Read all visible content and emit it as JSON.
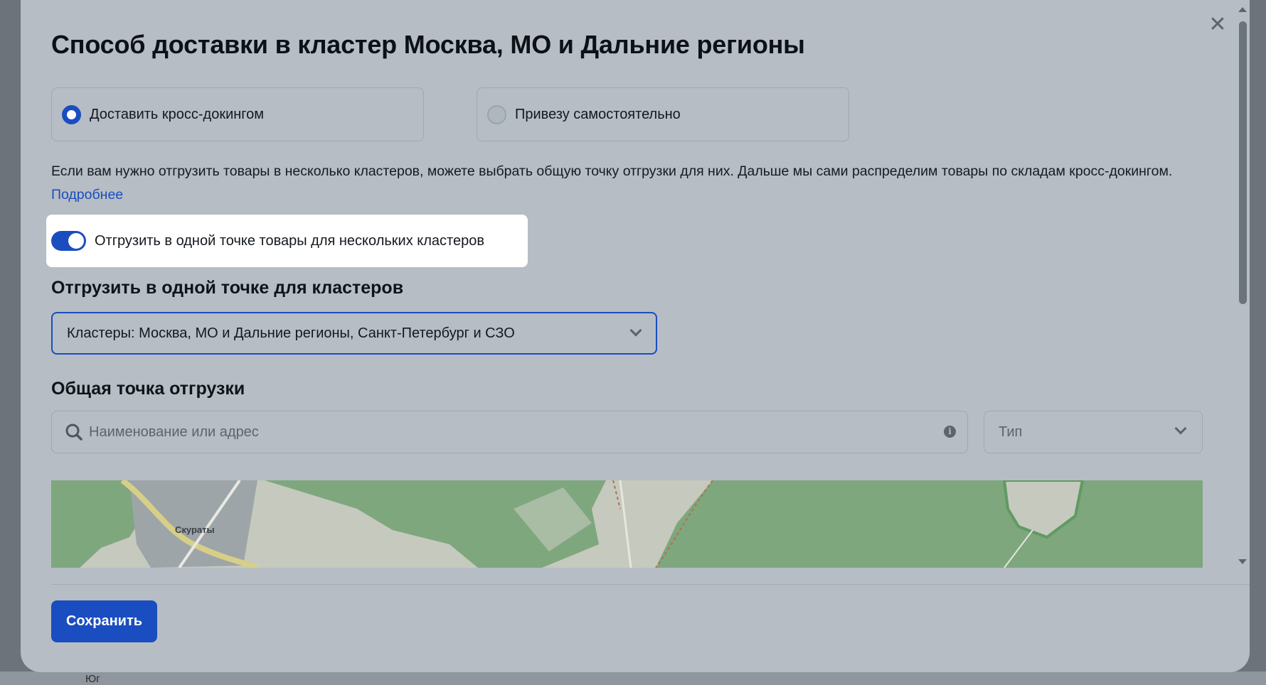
{
  "modal": {
    "title": "Способ доставки в кластер Москва, МО и Дальние регионы",
    "close_icon": "close-icon"
  },
  "delivery_options": [
    {
      "label": "Доставить кросс-докингом",
      "selected": true
    },
    {
      "label": "Привезу самостоятельно",
      "selected": false
    }
  ],
  "description": {
    "text": "Если вам нужно отгрузить товары в несколько кластеров, можете выбрать общую точку отгрузки для них. Дальше мы сами распределим товары по складам кросс-докингом.",
    "link": "Подробнее"
  },
  "toggle": {
    "label": "Отгрузить в одной точке товары для нескольких кластеров",
    "on": true
  },
  "clusters_section": {
    "heading": "Отгрузить в одной точке для кластеров",
    "select_value": "Кластеры: Москва, МО и Дальние регионы, Санкт-Петербург и СЗО"
  },
  "shipping_point": {
    "heading": "Общая точка отгрузки",
    "search_placeholder": "Наименование или адрес",
    "type_placeholder": "Тип"
  },
  "map": {
    "place_label": "Скураты"
  },
  "footer": {
    "save_label": "Сохранить"
  },
  "background_peek": {
    "text": "Юг"
  },
  "colors": {
    "accent": "#1a4dbf",
    "modal_bg": "#b6bdc4",
    "forest": "#7ea77d"
  }
}
